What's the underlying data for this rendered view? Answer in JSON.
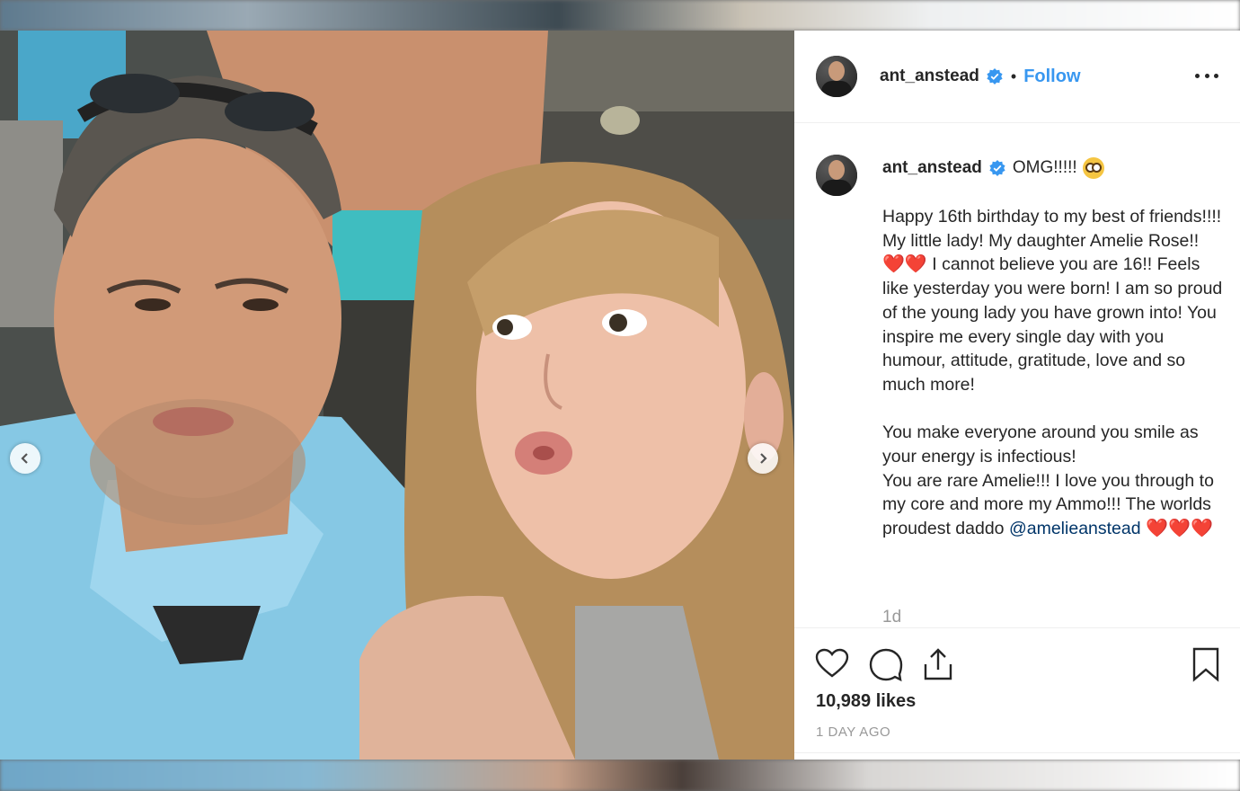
{
  "post": {
    "username": "ant_anstead",
    "separator": "•",
    "follow_label": "Follow",
    "more_icon": "more-options-icon"
  },
  "caption": {
    "username": "ant_anstead",
    "opener": "OMG!!!!!",
    "opener_emoji": "flushed-face-emoji",
    "paragraph1": {
      "text_a": "Happy 16th birthday to my best of friends!!!! My little lady! My daughter Amelie Rose!! ",
      "hearts_a": "❤️❤️",
      "text_b": " I cannot believe you are 16!! Feels like yesterday you were born! I am so proud of the young lady you have grown into! You inspire me every single day with you humour, attitude, gratitude, love and so much more!"
    },
    "paragraph2": {
      "text_a": "You make everyone around you smile as your energy is infectious!",
      "text_b": "You are rare Amelie!!! I love you through to my core and more my Ammo!!! The worlds proudest daddo",
      "mention": "@amelieanstead",
      "hearts_b": " ❤️❤️❤️"
    },
    "time_ago": "1d"
  },
  "actions": {
    "likes": "10,989 likes",
    "date": "1 DAY AGO"
  },
  "colors": {
    "link_blue": "#3897f0",
    "mention_blue": "#003569",
    "text": "#262626",
    "muted": "#999999"
  }
}
